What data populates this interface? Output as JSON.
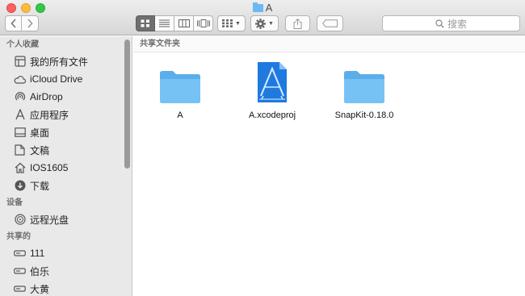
{
  "window": {
    "title": "A"
  },
  "toolbar": {
    "search_placeholder": "搜索"
  },
  "sidebar": {
    "sections": [
      {
        "title": "个人收藏",
        "items": [
          {
            "label": "我的所有文件",
            "icon": "all-files-icon"
          },
          {
            "label": "iCloud Drive",
            "icon": "cloud-icon"
          },
          {
            "label": "AirDrop",
            "icon": "airdrop-icon"
          },
          {
            "label": "应用程序",
            "icon": "applications-icon"
          },
          {
            "label": "桌面",
            "icon": "desktop-icon"
          },
          {
            "label": "文稿",
            "icon": "documents-icon"
          },
          {
            "label": "IOS1605",
            "icon": "home-icon"
          },
          {
            "label": "下载",
            "icon": "downloads-icon"
          }
        ]
      },
      {
        "title": "设备",
        "items": [
          {
            "label": "远程光盘",
            "icon": "remote-disc-icon"
          }
        ]
      },
      {
        "title": "共享的",
        "items": [
          {
            "label": "111",
            "icon": "network-host-icon"
          },
          {
            "label": "伯乐",
            "icon": "network-host-icon"
          },
          {
            "label": "大黄",
            "icon": "network-host-icon"
          }
        ]
      }
    ]
  },
  "main": {
    "header": "共享文件夹",
    "files": [
      {
        "name": "A",
        "icon": "folder-icon"
      },
      {
        "name": "A.xcodeproj",
        "icon": "xcodeproj-icon"
      },
      {
        "name": "SnapKit-0.18.0",
        "icon": "folder-icon"
      }
    ]
  },
  "colors": {
    "folder": "#6bb9f0",
    "xcode": "#1f7ae0",
    "sidebar_bg": "#e9e9e9"
  }
}
